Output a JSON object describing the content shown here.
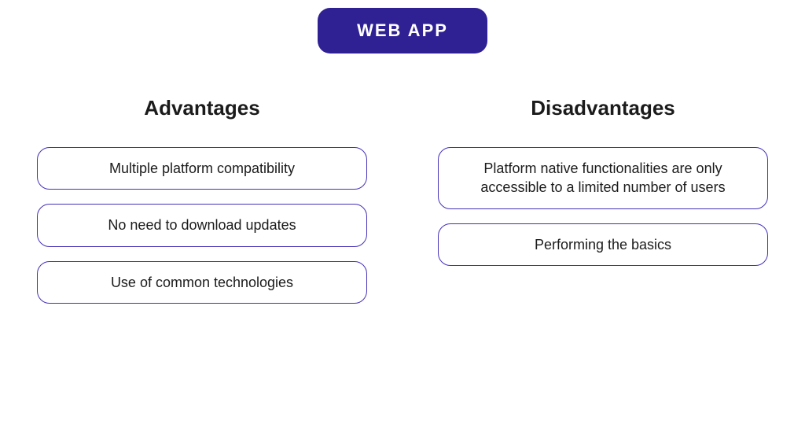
{
  "title": "WEB APP",
  "columns": {
    "advantages": {
      "heading": "Advantages",
      "items": [
        "Multiple platform compatibility",
        "No need to download updates",
        "Use of common technologies"
      ]
    },
    "disadvantages": {
      "heading": "Disadvantages",
      "items": [
        "Platform native functionalities are only accessible to a limited number of users",
        "Performing the basics"
      ]
    }
  }
}
